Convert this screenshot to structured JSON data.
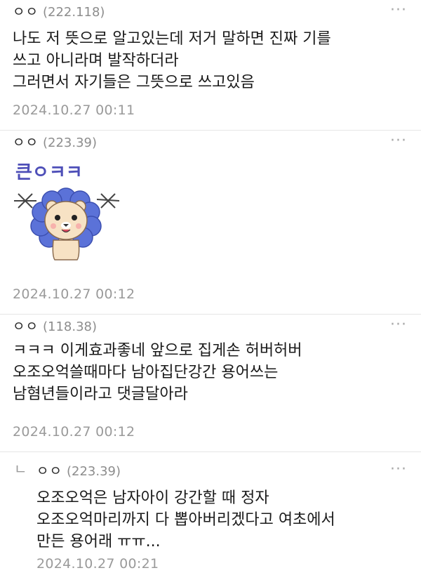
{
  "comments": [
    {
      "nickname": "ㅇㅇ",
      "ip": "(222.118)",
      "more": "···",
      "text": "나도 저 뜻으로 알고있는데 저거 말하면 진짜 기를\n쓰고 아니라며 발작하더라\n그러면서 자기들은 그뜻으로 쓰고있음",
      "date": "2024.10.27 00:11"
    },
    {
      "nickname": "ㅇㅇ",
      "ip": "(223.39)",
      "more": "···",
      "sticker": {
        "text": "큰ㅇㅋㅋ",
        "icon": "lion-sticker-icon",
        "mane_color": "#5570d6",
        "face_color": "#f7e2c4"
      },
      "date": "2024.10.27 00:12"
    },
    {
      "nickname": "ㅇㅇ",
      "ip": "(118.38)",
      "more": "···",
      "text": "ㅋㅋㅋ 이게효과좋네 앞으로 집게손 허버허버\n오조오억쓸때마다 남아집단강간 용어쓰는\n남혐년들이라고 댓글달아라",
      "date": "2024.10.27 00:12"
    },
    {
      "reply_marker": "ㄴ",
      "nickname": "ㅇㅇ",
      "ip": "(223.39)",
      "more": "···",
      "text": "오조오억은 남자아이 강간할 때 정자\n오조오억마리까지 다 뽑아버리겠다고 여초에서\n만든 용어래 ㅠㅠ...",
      "date": "2024.10.27 00:21"
    }
  ]
}
